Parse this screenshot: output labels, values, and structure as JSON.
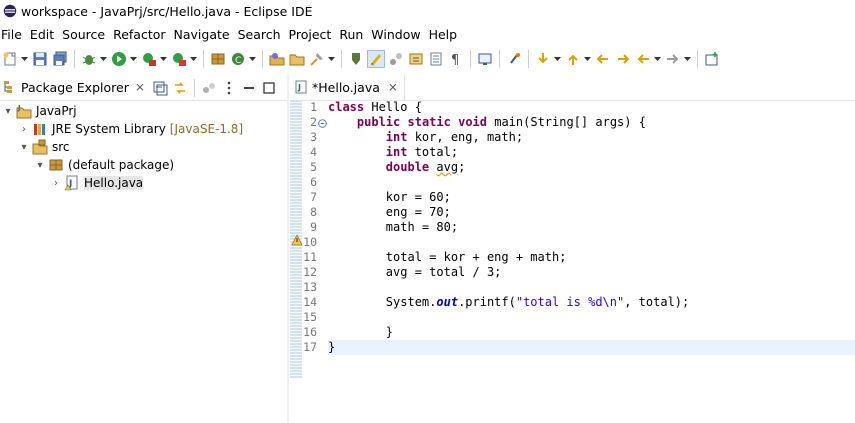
{
  "window": {
    "title": "workspace - JavaPrj/src/Hello.java - Eclipse IDE"
  },
  "menu": [
    "File",
    "Edit",
    "Source",
    "Refactor",
    "Navigate",
    "Search",
    "Project",
    "Run",
    "Window",
    "Help"
  ],
  "package_explorer": {
    "tab_label": "Package Explorer",
    "close_glyph": "⨯",
    "tree": [
      {
        "label": "JavaPrj",
        "icon": "java-project-icon"
      },
      {
        "label": "JRE System Library",
        "decoration": "[JavaSE-1.8]",
        "icon": "library-icon"
      },
      {
        "label": "src",
        "icon": "source-folder-icon"
      },
      {
        "label": "(default package)",
        "icon": "package-icon"
      },
      {
        "label": "Hello.java",
        "icon": "java-file-warning-icon"
      }
    ]
  },
  "editor": {
    "tab_label": "*Hello.java",
    "close_glyph": "⨯",
    "line_numbers": [
      "1",
      "2",
      "3",
      "4",
      "5",
      "6",
      "7",
      "8",
      "9",
      "10",
      "11",
      "12",
      "13",
      "14",
      "15",
      "16",
      "17"
    ],
    "lines": [
      "class Hello {",
      "    public static void main(String[] args) {",
      "        int kor, eng, math;",
      "        int total;",
      "        double avg;",
      "",
      "        kor = 60;",
      "        eng = 70;",
      "        math = 80;",
      "",
      "        total = kor + eng + math;",
      "        avg = total / 3;",
      "",
      "        System.out.printf(\"total is %d\\n\", total);",
      "",
      "        }",
      "}"
    ],
    "current_line": 17,
    "warning_line": 5
  },
  "colors": {
    "keyword": "#7f0055",
    "string": "#2a00ff",
    "field": "#0000c0",
    "current_line_bg": "#e8f2fe"
  }
}
